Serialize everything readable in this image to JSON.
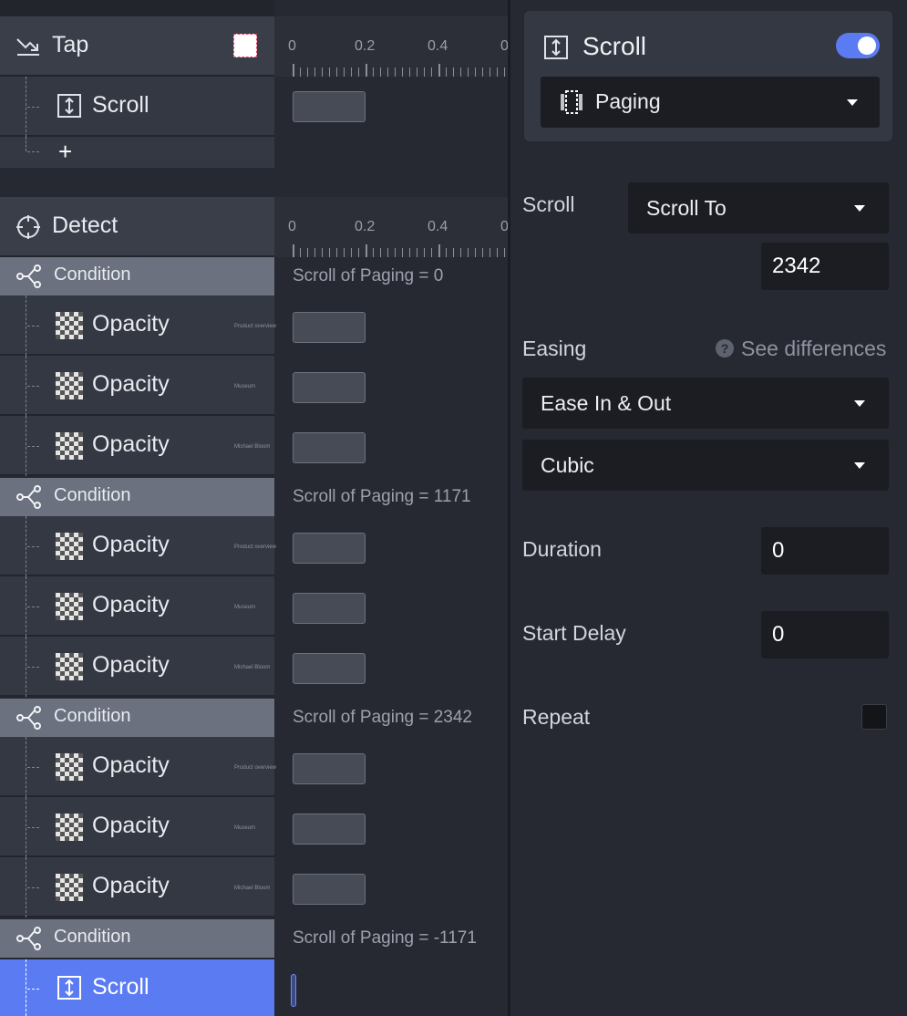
{
  "timeline": {
    "ticks": [
      "0",
      "0.2",
      "0.4",
      "0"
    ]
  },
  "tap_group": {
    "title": "Tap",
    "child_label": "Scroll",
    "add_label": "+"
  },
  "detect_group": {
    "title": "Detect",
    "conditions": [
      {
        "label": "Condition",
        "expression": "Scroll of Paging = 0",
        "actions": [
          {
            "label": "Opacity",
            "preview": "Product overview"
          },
          {
            "label": "Opacity",
            "preview": "Museum"
          },
          {
            "label": "Opacity",
            "preview": "Michael Bloom"
          }
        ]
      },
      {
        "label": "Condition",
        "expression": "Scroll of Paging = 1171",
        "actions": [
          {
            "label": "Opacity",
            "preview": "Product overview"
          },
          {
            "label": "Opacity",
            "preview": "Museum"
          },
          {
            "label": "Opacity",
            "preview": "Michael Bloom"
          }
        ]
      },
      {
        "label": "Condition",
        "expression": "Scroll of Paging = 2342",
        "actions": [
          {
            "label": "Opacity",
            "preview": "Product overview"
          },
          {
            "label": "Opacity",
            "preview": "Museum"
          },
          {
            "label": "Opacity",
            "preview": "Michael Bloom"
          }
        ]
      },
      {
        "label": "Condition",
        "expression": "Scroll of Paging = -1171",
        "actions": [
          {
            "label": "Scroll",
            "preview": ""
          }
        ]
      }
    ]
  },
  "inspector": {
    "title": "Scroll",
    "enabled": true,
    "target_layer": "Paging",
    "scroll_label": "Scroll",
    "scroll_mode": "Scroll To",
    "scroll_value": "2342",
    "easing_label": "Easing",
    "see_differences": "See differences",
    "help_glyph": "?",
    "easing_type": "Ease In & Out",
    "easing_curve": "Cubic",
    "duration_label": "Duration",
    "duration_value": "0",
    "start_delay_label": "Start Delay",
    "start_delay_value": "0",
    "repeat_label": "Repeat",
    "repeat_checked": false
  },
  "colors": {
    "accent": "#5b7bf2",
    "background": "#262932",
    "condition_row": "#6b717f",
    "field": "#1b1d22"
  }
}
